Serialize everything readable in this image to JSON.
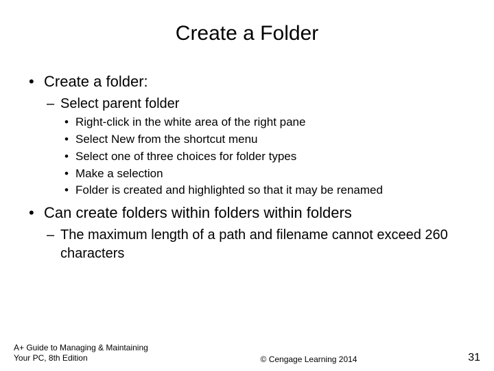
{
  "title": "Create a Folder",
  "bullets": [
    {
      "text": "Create a folder:",
      "children": [
        {
          "text": "Select parent folder",
          "children": [
            {
              "text": "Right-click in the white area of the right pane"
            },
            {
              "text": "Select New from the shortcut menu"
            },
            {
              "text": "Select one of three choices for folder types"
            },
            {
              "text": "Make a selection"
            },
            {
              "text": "Folder is created and highlighted so that it may be renamed"
            }
          ]
        }
      ]
    },
    {
      "text": "Can create folders within folders within folders",
      "children": [
        {
          "text": "The maximum length of a path and filename cannot exceed 260 characters"
        }
      ]
    }
  ],
  "footer": {
    "left": "A+ Guide to Managing & Maintaining Your PC, 8th Edition",
    "center": "© Cengage Learning 2014",
    "page": "31"
  }
}
